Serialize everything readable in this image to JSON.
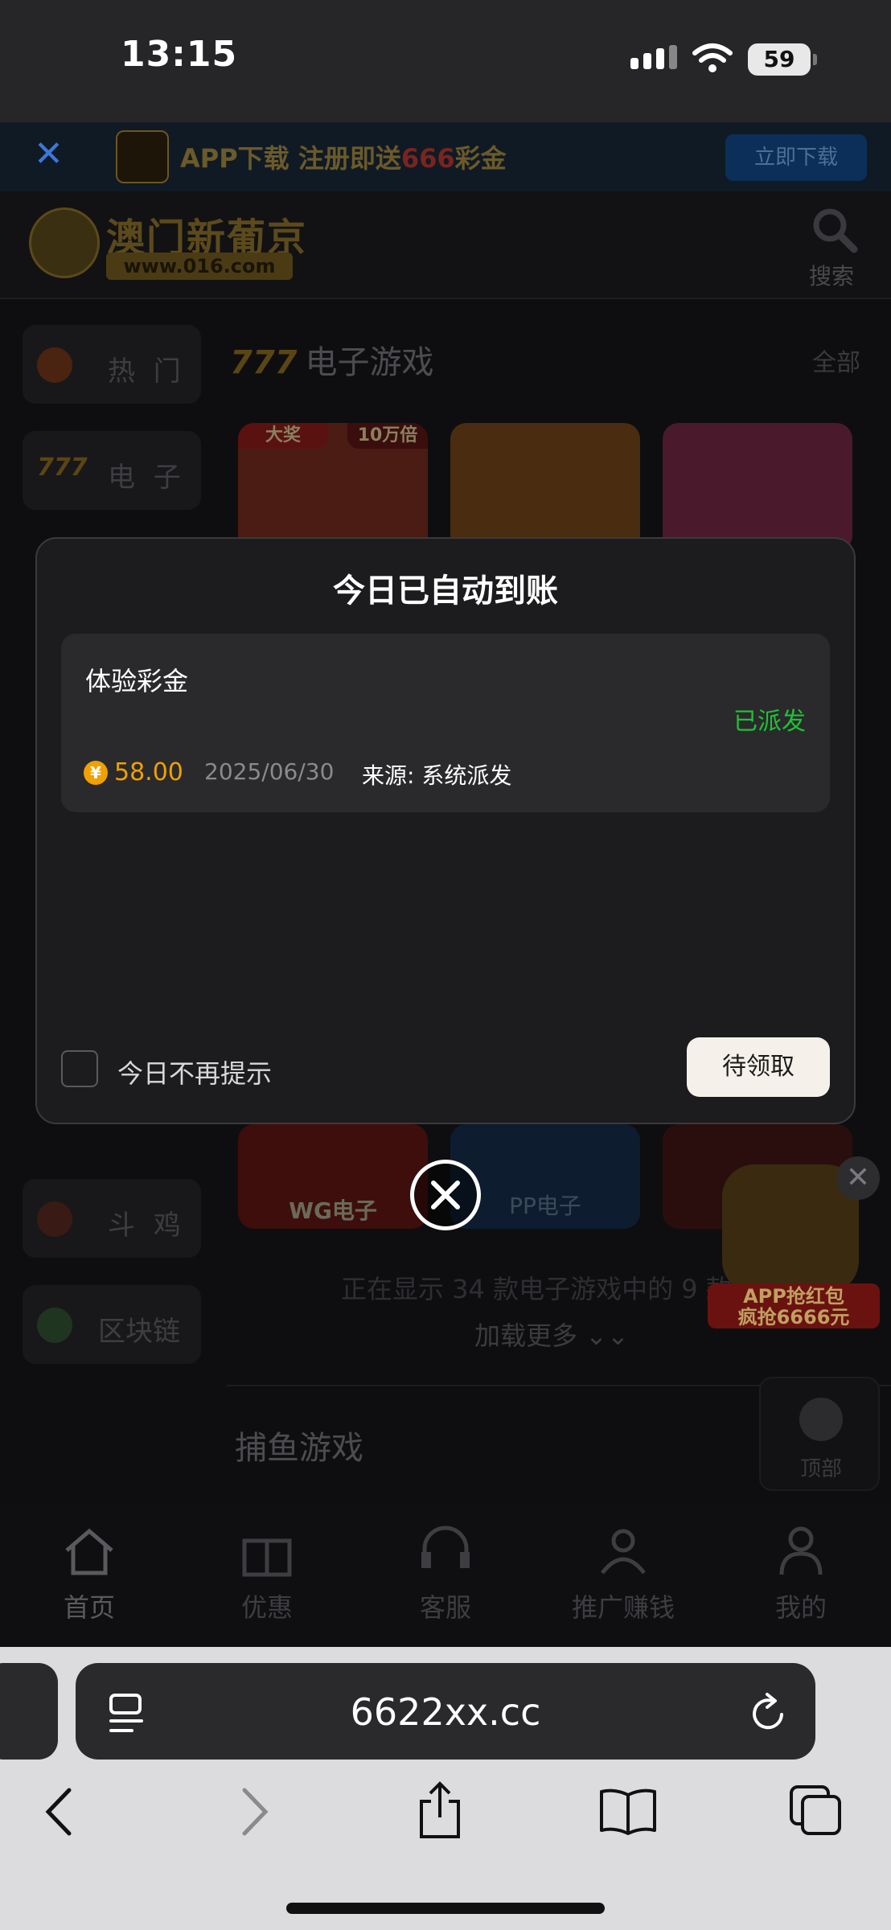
{
  "status_bar": {
    "time": "13:15",
    "battery": "59"
  },
  "app_banner": {
    "text_a": "APP下载 注册即送",
    "text_red": "666",
    "text_b": "彩金",
    "download_label": "立即下载"
  },
  "header": {
    "logo_title": "澳门新葡京",
    "logo_url": "www.016.com",
    "search_label": "搜索"
  },
  "sidebar": [
    {
      "label": "热 门",
      "icon": "fire-icon"
    },
    {
      "label": "电 子",
      "icon": "777-icon"
    },
    {
      "label": "斗 鸡",
      "icon": "rooster-icon"
    },
    {
      "label": "区块链",
      "icon": "blockchain-icon"
    }
  ],
  "section": {
    "prefix": "777",
    "title": "电子游戏",
    "all_label": "全部",
    "tag_left": "大奖",
    "tag_right": "10万倍",
    "card_wg": "WG电子",
    "card_pp": "PP电子",
    "showing": "正在显示 34 款电子游戏中的 9 款",
    "load_more": "加载更多 ⌄⌄"
  },
  "section2": {
    "title": "捕鱼游戏"
  },
  "promo": {
    "line1": "APP抢红包",
    "line2": "疯抢6666元"
  },
  "top_button": {
    "label": "顶部"
  },
  "bottom_nav": [
    "首页",
    "优惠",
    "客服",
    "推广赚钱",
    "我的"
  ],
  "modal": {
    "title": "今日已自动到账",
    "record": {
      "name": "体验彩金",
      "status": "已派发",
      "currency_symbol": "¥",
      "amount": "58.00",
      "date": "2025/06/30",
      "source": "来源: 系统派发"
    },
    "checkbox_label": "今日不再提示",
    "claim_label": "待领取"
  },
  "browser": {
    "url": "6622xx.cc"
  },
  "colors": {
    "accent_gold": "#f0a000",
    "status_green": "#1ec234",
    "modal_bg": "#1c1c1e"
  }
}
